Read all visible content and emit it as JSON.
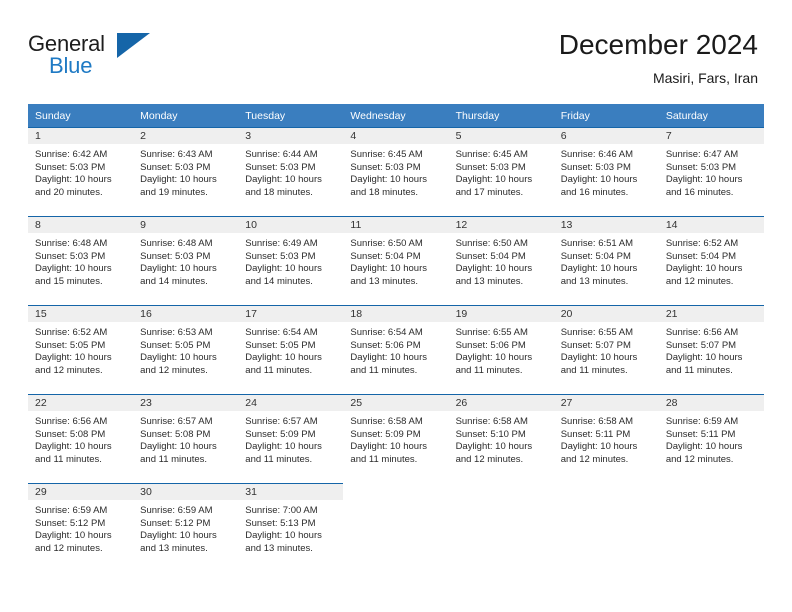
{
  "brand": {
    "name_part1": "General",
    "name_part2": "Blue",
    "triangle_color": "#1565a8",
    "blue_color": "#1f7ac4"
  },
  "header": {
    "title": "December 2024",
    "subtitle": "Masiri, Fars, Iran"
  },
  "theme": {
    "header_row_bg": "#3a7ebf",
    "date_bar_bg": "#efefef",
    "date_bar_border": "#1565a8",
    "text": "#2b2b2b"
  },
  "weekdays": [
    "Sunday",
    "Monday",
    "Tuesday",
    "Wednesday",
    "Thursday",
    "Friday",
    "Saturday"
  ],
  "weeks": [
    [
      {
        "date": "1",
        "sunrise": "Sunrise: 6:42 AM",
        "sunset": "Sunset: 5:03 PM",
        "daylight1": "Daylight: 10 hours",
        "daylight2": "and 20 minutes."
      },
      {
        "date": "2",
        "sunrise": "Sunrise: 6:43 AM",
        "sunset": "Sunset: 5:03 PM",
        "daylight1": "Daylight: 10 hours",
        "daylight2": "and 19 minutes."
      },
      {
        "date": "3",
        "sunrise": "Sunrise: 6:44 AM",
        "sunset": "Sunset: 5:03 PM",
        "daylight1": "Daylight: 10 hours",
        "daylight2": "and 18 minutes."
      },
      {
        "date": "4",
        "sunrise": "Sunrise: 6:45 AM",
        "sunset": "Sunset: 5:03 PM",
        "daylight1": "Daylight: 10 hours",
        "daylight2": "and 18 minutes."
      },
      {
        "date": "5",
        "sunrise": "Sunrise: 6:45 AM",
        "sunset": "Sunset: 5:03 PM",
        "daylight1": "Daylight: 10 hours",
        "daylight2": "and 17 minutes."
      },
      {
        "date": "6",
        "sunrise": "Sunrise: 6:46 AM",
        "sunset": "Sunset: 5:03 PM",
        "daylight1": "Daylight: 10 hours",
        "daylight2": "and 16 minutes."
      },
      {
        "date": "7",
        "sunrise": "Sunrise: 6:47 AM",
        "sunset": "Sunset: 5:03 PM",
        "daylight1": "Daylight: 10 hours",
        "daylight2": "and 16 minutes."
      }
    ],
    [
      {
        "date": "8",
        "sunrise": "Sunrise: 6:48 AM",
        "sunset": "Sunset: 5:03 PM",
        "daylight1": "Daylight: 10 hours",
        "daylight2": "and 15 minutes."
      },
      {
        "date": "9",
        "sunrise": "Sunrise: 6:48 AM",
        "sunset": "Sunset: 5:03 PM",
        "daylight1": "Daylight: 10 hours",
        "daylight2": "and 14 minutes."
      },
      {
        "date": "10",
        "sunrise": "Sunrise: 6:49 AM",
        "sunset": "Sunset: 5:03 PM",
        "daylight1": "Daylight: 10 hours",
        "daylight2": "and 14 minutes."
      },
      {
        "date": "11",
        "sunrise": "Sunrise: 6:50 AM",
        "sunset": "Sunset: 5:04 PM",
        "daylight1": "Daylight: 10 hours",
        "daylight2": "and 13 minutes."
      },
      {
        "date": "12",
        "sunrise": "Sunrise: 6:50 AM",
        "sunset": "Sunset: 5:04 PM",
        "daylight1": "Daylight: 10 hours",
        "daylight2": "and 13 minutes."
      },
      {
        "date": "13",
        "sunrise": "Sunrise: 6:51 AM",
        "sunset": "Sunset: 5:04 PM",
        "daylight1": "Daylight: 10 hours",
        "daylight2": "and 13 minutes."
      },
      {
        "date": "14",
        "sunrise": "Sunrise: 6:52 AM",
        "sunset": "Sunset: 5:04 PM",
        "daylight1": "Daylight: 10 hours",
        "daylight2": "and 12 minutes."
      }
    ],
    [
      {
        "date": "15",
        "sunrise": "Sunrise: 6:52 AM",
        "sunset": "Sunset: 5:05 PM",
        "daylight1": "Daylight: 10 hours",
        "daylight2": "and 12 minutes."
      },
      {
        "date": "16",
        "sunrise": "Sunrise: 6:53 AM",
        "sunset": "Sunset: 5:05 PM",
        "daylight1": "Daylight: 10 hours",
        "daylight2": "and 12 minutes."
      },
      {
        "date": "17",
        "sunrise": "Sunrise: 6:54 AM",
        "sunset": "Sunset: 5:05 PM",
        "daylight1": "Daylight: 10 hours",
        "daylight2": "and 11 minutes."
      },
      {
        "date": "18",
        "sunrise": "Sunrise: 6:54 AM",
        "sunset": "Sunset: 5:06 PM",
        "daylight1": "Daylight: 10 hours",
        "daylight2": "and 11 minutes."
      },
      {
        "date": "19",
        "sunrise": "Sunrise: 6:55 AM",
        "sunset": "Sunset: 5:06 PM",
        "daylight1": "Daylight: 10 hours",
        "daylight2": "and 11 minutes."
      },
      {
        "date": "20",
        "sunrise": "Sunrise: 6:55 AM",
        "sunset": "Sunset: 5:07 PM",
        "daylight1": "Daylight: 10 hours",
        "daylight2": "and 11 minutes."
      },
      {
        "date": "21",
        "sunrise": "Sunrise: 6:56 AM",
        "sunset": "Sunset: 5:07 PM",
        "daylight1": "Daylight: 10 hours",
        "daylight2": "and 11 minutes."
      }
    ],
    [
      {
        "date": "22",
        "sunrise": "Sunrise: 6:56 AM",
        "sunset": "Sunset: 5:08 PM",
        "daylight1": "Daylight: 10 hours",
        "daylight2": "and 11 minutes."
      },
      {
        "date": "23",
        "sunrise": "Sunrise: 6:57 AM",
        "sunset": "Sunset: 5:08 PM",
        "daylight1": "Daylight: 10 hours",
        "daylight2": "and 11 minutes."
      },
      {
        "date": "24",
        "sunrise": "Sunrise: 6:57 AM",
        "sunset": "Sunset: 5:09 PM",
        "daylight1": "Daylight: 10 hours",
        "daylight2": "and 11 minutes."
      },
      {
        "date": "25",
        "sunrise": "Sunrise: 6:58 AM",
        "sunset": "Sunset: 5:09 PM",
        "daylight1": "Daylight: 10 hours",
        "daylight2": "and 11 minutes."
      },
      {
        "date": "26",
        "sunrise": "Sunrise: 6:58 AM",
        "sunset": "Sunset: 5:10 PM",
        "daylight1": "Daylight: 10 hours",
        "daylight2": "and 12 minutes."
      },
      {
        "date": "27",
        "sunrise": "Sunrise: 6:58 AM",
        "sunset": "Sunset: 5:11 PM",
        "daylight1": "Daylight: 10 hours",
        "daylight2": "and 12 minutes."
      },
      {
        "date": "28",
        "sunrise": "Sunrise: 6:59 AM",
        "sunset": "Sunset: 5:11 PM",
        "daylight1": "Daylight: 10 hours",
        "daylight2": "and 12 minutes."
      }
    ],
    [
      {
        "date": "29",
        "sunrise": "Sunrise: 6:59 AM",
        "sunset": "Sunset: 5:12 PM",
        "daylight1": "Daylight: 10 hours",
        "daylight2": "and 12 minutes."
      },
      {
        "date": "30",
        "sunrise": "Sunrise: 6:59 AM",
        "sunset": "Sunset: 5:12 PM",
        "daylight1": "Daylight: 10 hours",
        "daylight2": "and 13 minutes."
      },
      {
        "date": "31",
        "sunrise": "Sunrise: 7:00 AM",
        "sunset": "Sunset: 5:13 PM",
        "daylight1": "Daylight: 10 hours",
        "daylight2": "and 13 minutes."
      },
      {
        "date": "",
        "sunrise": "",
        "sunset": "",
        "daylight1": "",
        "daylight2": ""
      },
      {
        "date": "",
        "sunrise": "",
        "sunset": "",
        "daylight1": "",
        "daylight2": ""
      },
      {
        "date": "",
        "sunrise": "",
        "sunset": "",
        "daylight1": "",
        "daylight2": ""
      },
      {
        "date": "",
        "sunrise": "",
        "sunset": "",
        "daylight1": "",
        "daylight2": ""
      }
    ]
  ]
}
